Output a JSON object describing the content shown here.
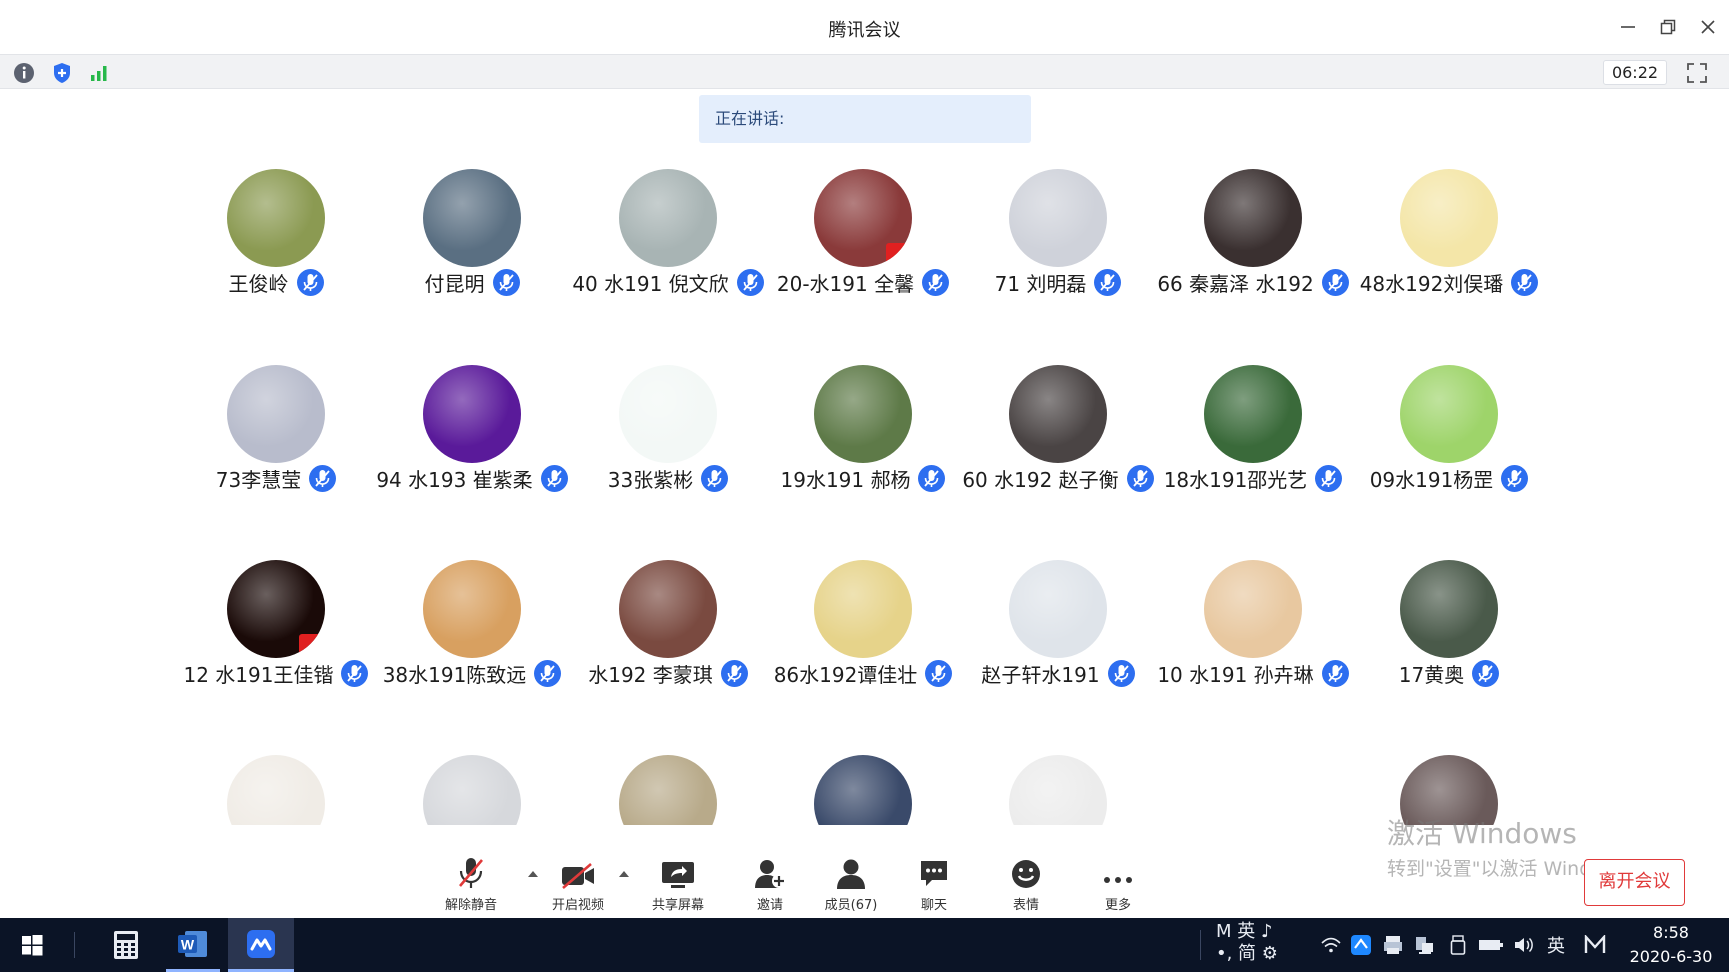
{
  "window": {
    "title": "腾讯会议"
  },
  "toolbar": {
    "timer": "06:22"
  },
  "speaking": {
    "label": "正在讲话:"
  },
  "participants": [
    {
      "name": "王俊岭",
      "avatar_color": "#8b9a52"
    },
    {
      "name": "付昆明",
      "avatar_color": "#5a6f82"
    },
    {
      "name": "40 水191 倪文欣",
      "avatar_color": "#a8b4b4"
    },
    {
      "name": "20-水191 全馨",
      "avatar_color": "#8a3a3a"
    },
    {
      "name": "71 刘明磊",
      "avatar_color": "#cfd2da"
    },
    {
      "name": "66 秦嘉泽 水192",
      "avatar_color": "#3a3030"
    },
    {
      "name": "48水192刘俣璠",
      "avatar_color": "#f4e6a8"
    },
    {
      "name": "73李慧莹",
      "avatar_color": "#b8bccc"
    },
    {
      "name": "94 水193 崔紫柔",
      "avatar_color": "#5a1a9a"
    },
    {
      "name": "33张紫彬",
      "avatar_color": "#f3f8f6"
    },
    {
      "name": "19水191 郝杨",
      "avatar_color": "#5e7a48"
    },
    {
      "name": "60 水192 赵子衡",
      "avatar_color": "#4a4444"
    },
    {
      "name": "18水191邵光艺",
      "avatar_color": "#3a6a3a"
    },
    {
      "name": "09水191杨罡",
      "avatar_color": "#9ed46a"
    },
    {
      "name": "12 水191王佳锴",
      "avatar_color": "#1a0a08"
    },
    {
      "name": "38水191陈致远",
      "avatar_color": "#d8a060"
    },
    {
      "name": "水192 李蒙琪",
      "avatar_color": "#7a4a40"
    },
    {
      "name": "86水192谭佳壮",
      "avatar_color": "#e6d38a"
    },
    {
      "name": "赵子轩水191",
      "avatar_color": "#dfe4ea"
    },
    {
      "name": "10 水191 孙卉琳",
      "avatar_color": "#e8c8a0"
    },
    {
      "name": "17黄奥",
      "avatar_color": "#4a5a4a"
    }
  ],
  "clipped_avatars": [
    "#f0ece6",
    "#d6d8dc",
    "#b8aa8a",
    "#3a4a6a",
    "#ececec",
    "#6a5a5a"
  ],
  "controls": {
    "unmute": "解除静音",
    "video": "开启视频",
    "share": "共享屏幕",
    "invite": "邀请",
    "members": "成员(67)",
    "chat": "聊天",
    "emoji": "表情",
    "more": "更多",
    "leave": "离开会议"
  },
  "watermark": {
    "line1": "激活 Windows",
    "line2": "转到\"设置\"以激活 Windows。"
  },
  "taskbar": {
    "ime_top": "M 英 ♪",
    "ime_bottom": "•, 简 ⚙",
    "lang": "英",
    "time": "8:58",
    "date": "2020-6-30"
  },
  "colors": {
    "accent": "#2d6ef0",
    "danger": "#e03a3a",
    "taskbar": "#0b1426"
  }
}
